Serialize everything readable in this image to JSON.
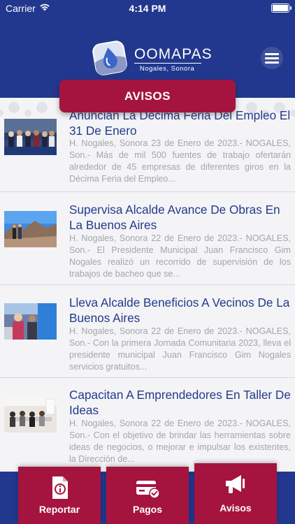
{
  "status_bar": {
    "carrier": "Carrier",
    "time": "4:14 PM"
  },
  "header": {
    "logo": {
      "name": "OOMAPAS",
      "subtitle": "Nogales, Sonora"
    },
    "menu_icon": "hamburger-icon"
  },
  "section": {
    "title": "AVISOS"
  },
  "news": [
    {
      "title": "Anuncian La Décima Feria Del Empleo El 31 De Enero",
      "excerpt": "H. Nogales, Sonora 23 de Enero de 2023.- NOGALES, Son.- Más de mil 500 fuentes de trabajo ofertarán alrededor de 45 empresas de diferentes giros en la Décima Feria del Empleo..."
    },
    {
      "title": "Supervisa Alcalde Avance De Obras En La Buenos Aires",
      "excerpt": "H. Nogales, Sonora 22 de Enero de 2023.- NOGALES, Son.- El Presidente Municipal Juan Francisco Gim Nogales realizó un recorrido de supervisión de los trabajos de bacheo que se..."
    },
    {
      "title": "Lleva Alcalde Beneficios A Vecinos De La Buenos Aires",
      "excerpt": "H. Nogales, Sonora 22 de Enero de 2023.- NOGALES, Son.- Con la primera Jornada Comunitaria 2023, lleva el presidente municipal Juan Francisco Gim Nogales servicios gratuitos..."
    },
    {
      "title": "Capacitan A Emprendedores En Taller De Ideas",
      "excerpt": "H. Nogales, Sonora 22 de Enero de 2023.- NOGALES, Son.- Con el objetivo de brindar las herramientas sobre ideas de negocios, o mejorar e impulsar los existentes, la Dirección de..."
    }
  ],
  "bottom_nav": [
    {
      "label": "Reportar",
      "icon": "report-icon"
    },
    {
      "label": "Pagos",
      "icon": "payment-card-icon"
    },
    {
      "label": "Avisos",
      "icon": "megaphone-icon",
      "active": true
    }
  ],
  "colors": {
    "brand_blue": "#22388f",
    "accent_red": "#a5143f",
    "title_blue": "#233a8c",
    "excerpt_gray": "#a3a6ad"
  }
}
